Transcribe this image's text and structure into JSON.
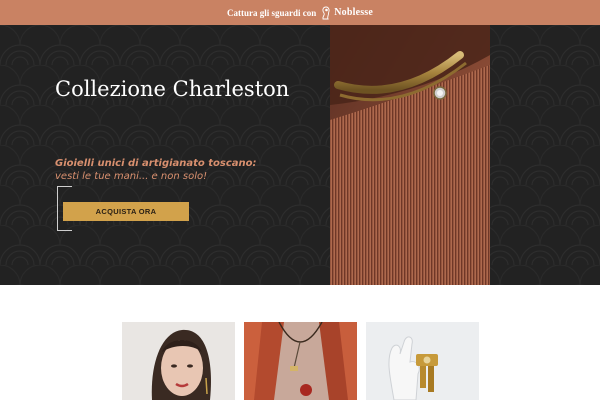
{
  "topbar": {
    "text": "Cattura gli sguardi con",
    "brand_name": "Noblesse",
    "icon": "woman-profile-logo-icon"
  },
  "hero": {
    "title": "Collezione Charleston",
    "subtitle_bold": "Gioielli unici di artigianato toscano:",
    "subtitle": "vesti le tue mani... e non solo!",
    "cta_label": "ACQUISTA ORA"
  },
  "gallery": {
    "items": [
      {
        "image": "woman-portrait-photo"
      },
      {
        "image": "necklace-on-model-photo"
      },
      {
        "image": "ring-on-hand-display-photo"
      }
    ]
  },
  "colors": {
    "accent": "#c98263",
    "button": "#d2a24b",
    "hero_bg": "#222222"
  }
}
